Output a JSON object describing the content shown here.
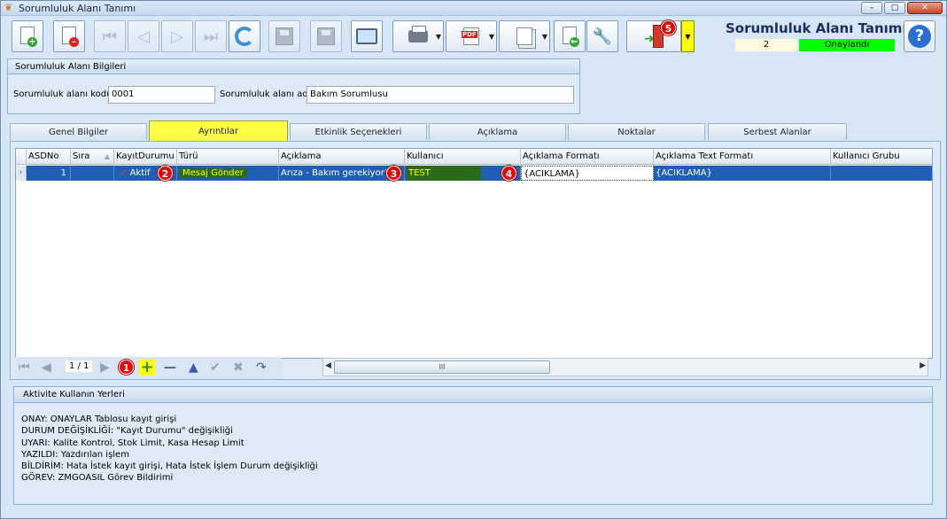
{
  "window": {
    "title": "Sorumluluk Alanı Tanımı",
    "controls": [
      "–",
      "▢",
      "✕"
    ]
  },
  "header": {
    "form_title": "Sorumluluk Alanı Tanımı",
    "record_number": "2",
    "record_status": "Onaylandı",
    "status_color": "#00ff00"
  },
  "markers": [
    "1",
    "2",
    "3",
    "4",
    "5"
  ],
  "group": {
    "title": "Sorumluluk Alanı Bilgileri",
    "code_label": "Sorumluluk alanı kodu",
    "code_value": "0001",
    "name_label": "Sorumluluk alanı adı",
    "name_value": "Bakım Sorumlusu"
  },
  "tabs": [
    {
      "label": "Genel Bilgiler",
      "active": false
    },
    {
      "label": "Ayrıntılar",
      "active": true
    },
    {
      "label": "Etkinlik Seçenekleri",
      "active": false
    },
    {
      "label": "Açıklama",
      "active": false
    },
    {
      "label": "Noktalar",
      "active": false
    },
    {
      "label": "Serbest Alanlar",
      "active": false
    }
  ],
  "grid": {
    "columns": [
      "ASDNo",
      "Sıra",
      "KayıtDurumu",
      "Türü",
      "Açıklama",
      "Kullanıcı",
      "Açıklama Formatı",
      "Açıklama Text Formatı",
      "Kullanıcı Grubu"
    ],
    "row": {
      "asdno": "1",
      "sira": "",
      "kayit_durumu": "Aktif",
      "turu": "Mesaj Gönder",
      "aciklama": "Arıza - Bakım gerekiyor!",
      "kullanici": "TEST",
      "aciklama_formati": "{ACIKLAMA}",
      "aciklama_text_formati": "{ACIKLAMA}",
      "kullanici_grubu": ""
    },
    "pager": "1 / 1",
    "scroll_grip": "III"
  },
  "info": {
    "title": "Aktivite Kullanın Yerleri",
    "lines": [
      "ONAY: ONAYLAR Tablosu kayıt girişi",
      "DURUM DEĞİŞİKLİĞİ: \"Kayıt Durumu\" değişikliği",
      "UYARI: Kalite Kontrol, Stok Limit, Kasa Hesap Limit",
      "YAZILDI: Yazdırılan işlem",
      "BİLDİRİM: Hata İstek kayıt girişi, Hata İstek İşlem Durum değişikliği",
      "GÖREV: ZMGOASIL Görev Bildirimi"
    ]
  }
}
